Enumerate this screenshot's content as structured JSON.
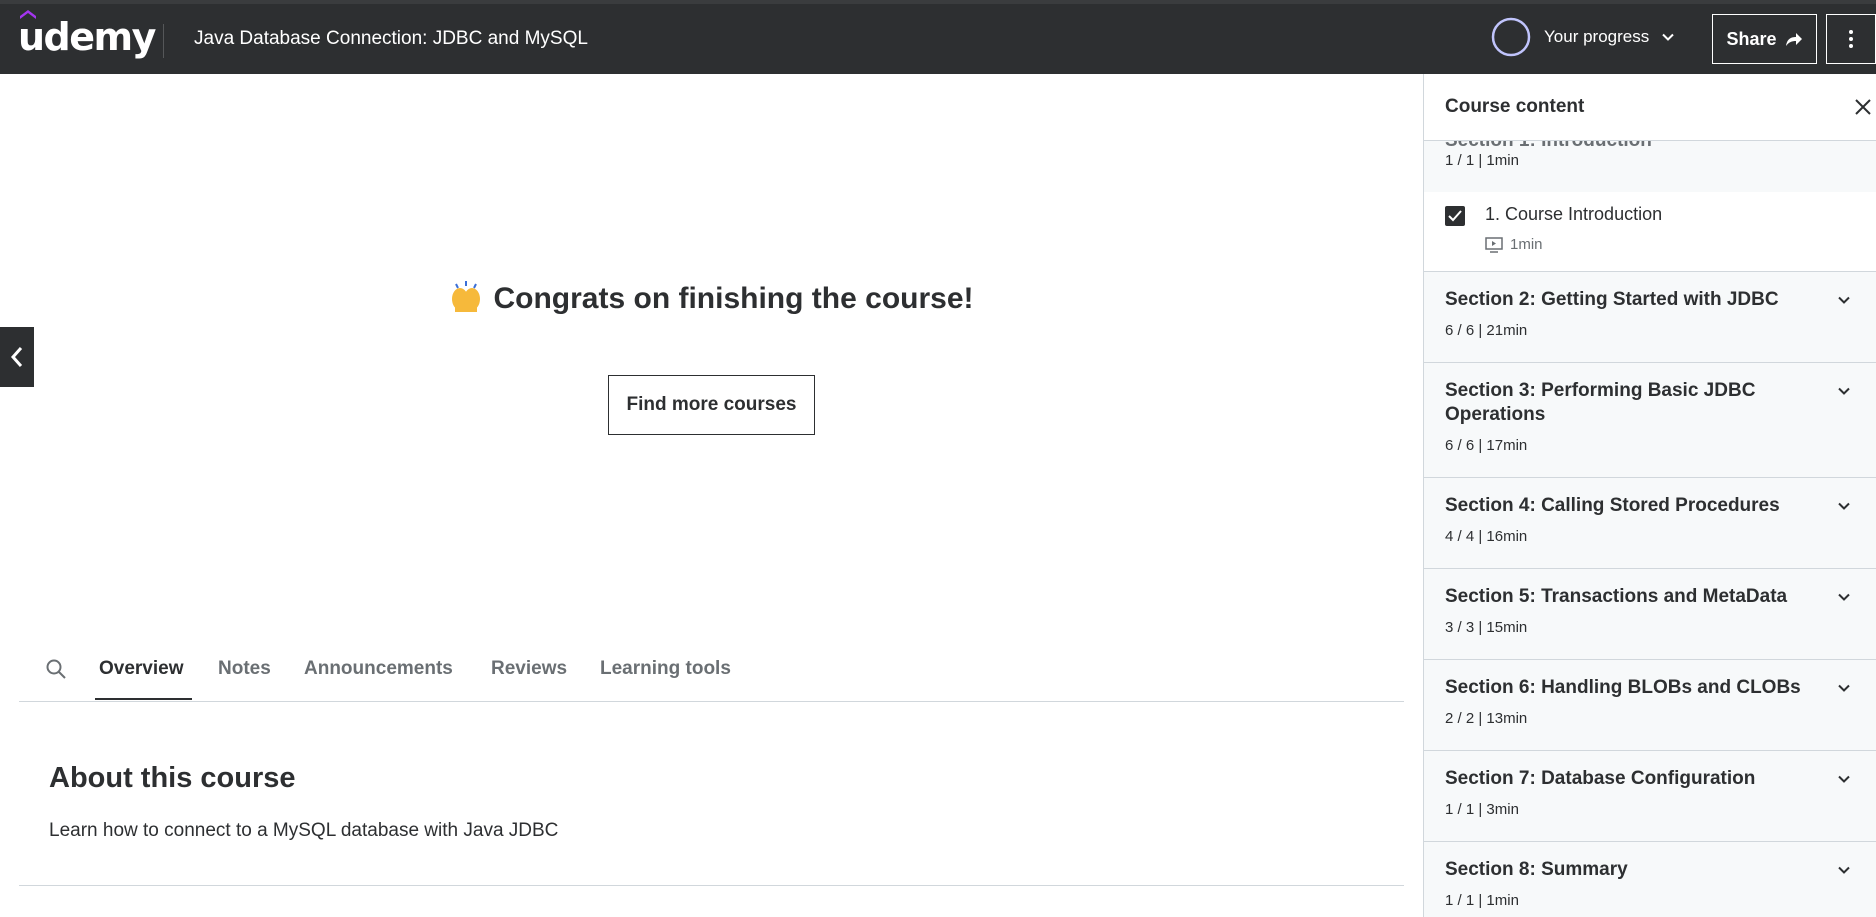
{
  "header": {
    "logo": "udemy",
    "course_title": "Java Database Connection: JDBC and MySQL",
    "progress_label": "Your progress",
    "share_label": "Share",
    "accent_color": "#a435f0"
  },
  "main": {
    "congrats": "Congrats on finishing the course!",
    "find_more": "Find more courses",
    "tabs": [
      {
        "label": "Overview",
        "active": true
      },
      {
        "label": "Notes"
      },
      {
        "label": "Announcements"
      },
      {
        "label": "Reviews"
      },
      {
        "label": "Learning tools"
      }
    ],
    "about_title": "About this course",
    "about_desc": "Learn how to connect to a MySQL database with Java JDBC"
  },
  "sidebar": {
    "title": "Course content",
    "first_section": {
      "ghost_title": "Section 1: Introduction",
      "meta": "1 / 1 | 1min"
    },
    "lecture": {
      "title": "1. Course Introduction",
      "duration": "1min",
      "completed": true
    },
    "sections": [
      {
        "title": "Section 2: Getting Started with JDBC",
        "meta": "6 / 6 | 21min"
      },
      {
        "title": "Section 3: Performing Basic JDBC Operations",
        "meta": "6 / 6 | 17min"
      },
      {
        "title": "Section 4: Calling Stored Procedures",
        "meta": "4 / 4 | 16min"
      },
      {
        "title": "Section 5: Transactions and MetaData",
        "meta": "3 / 3 | 15min"
      },
      {
        "title": "Section 6: Handling BLOBs and CLOBs",
        "meta": "2 / 2 | 13min"
      },
      {
        "title": "Section 7: Database Configuration",
        "meta": "1 / 1 | 3min"
      },
      {
        "title": "Section 8: Summary",
        "meta": "1 / 1 | 1min"
      }
    ]
  }
}
